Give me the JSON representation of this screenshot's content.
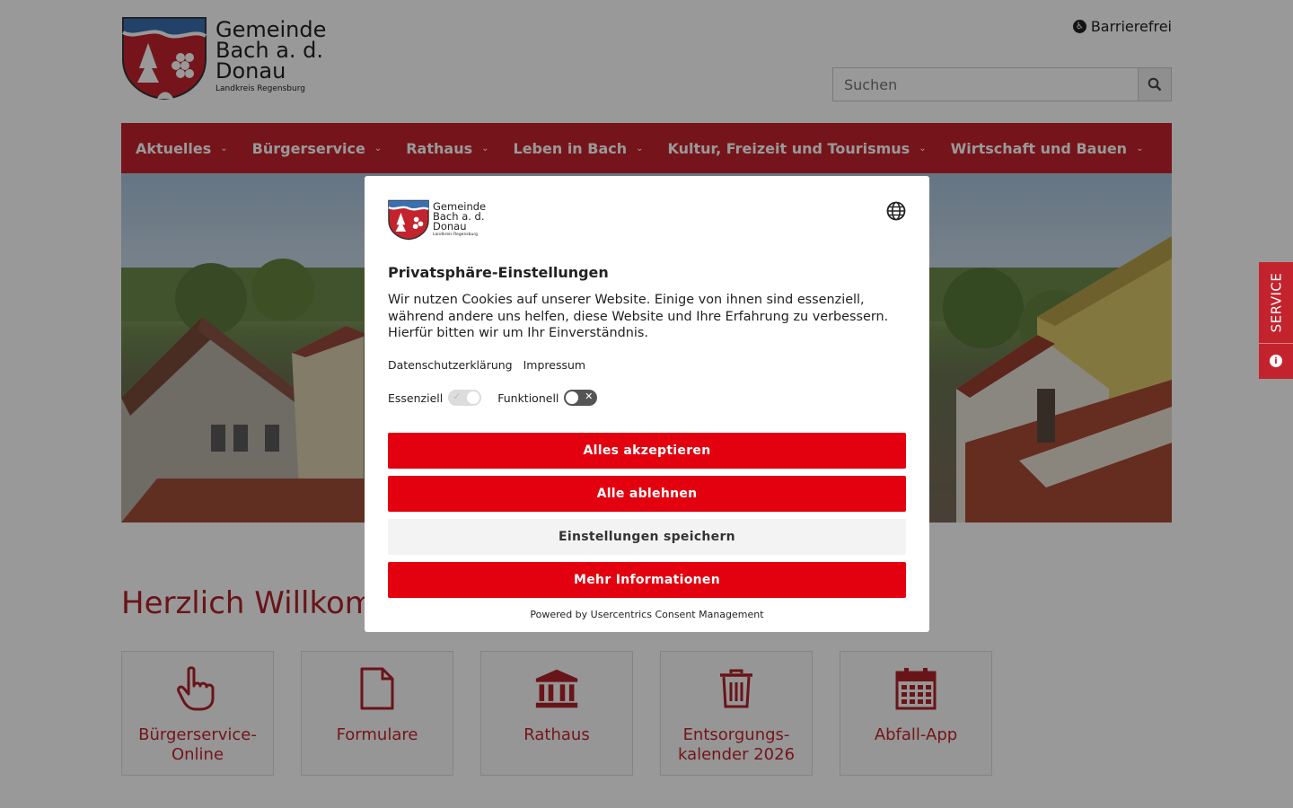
{
  "header": {
    "logo": {
      "line1": "Gemeinde",
      "line2": "Bach a. d.",
      "line3": "Donau",
      "subtitle": "Landkreis Regensburg"
    },
    "accessibility_label": "Barrierefrei",
    "search": {
      "placeholder": "Suchen",
      "icon": "search-icon"
    }
  },
  "nav": {
    "items": [
      {
        "label": "Aktuelles"
      },
      {
        "label": "Bürgerservice"
      },
      {
        "label": "Rathaus"
      },
      {
        "label": "Leben in Bach"
      },
      {
        "label": "Kultur, Freizeit und Tourismus"
      },
      {
        "label": "Wirtschaft und Bauen"
      }
    ]
  },
  "main": {
    "welcome": "Herzlich Willkommen",
    "tiles": [
      {
        "label": "Bürgerservice-Online",
        "icon": "pointing-hand-icon"
      },
      {
        "label": "Formulare",
        "icon": "document-icon"
      },
      {
        "label": "Rathaus",
        "icon": "town-hall-icon"
      },
      {
        "label": "Entsorgungs-kalender 2026",
        "icon": "trash-icon"
      },
      {
        "label": "Abfall-App",
        "icon": "calendar-icon"
      }
    ]
  },
  "service_tab": {
    "label": "SERVICE",
    "icon": "info-icon"
  },
  "consent": {
    "logo": {
      "line1": "Gemeinde",
      "line2": "Bach a. d.",
      "line3": "Donau",
      "subtitle": "Landkreis Regensburg"
    },
    "language_icon": "globe-icon",
    "title": "Privatsphäre-Einstellungen",
    "description": "Wir nutzen Cookies auf unserer Website. Einige von ihnen sind essenziell, während andere uns helfen, diese Website und Ihre Erfahrung zu verbessern. Hierfür bitten wir um Ihr Einverständnis.",
    "links": {
      "privacy": "Datenschutzerklärung",
      "imprint": "Impressum"
    },
    "toggles": [
      {
        "label": "Essenziell",
        "state": "on-disabled"
      },
      {
        "label": "Funktionell",
        "state": "off"
      }
    ],
    "buttons": {
      "accept_all": "Alles akzeptieren",
      "deny_all": "Alle ablehnen",
      "save": "Einstellungen speichern",
      "more_info": "Mehr Informationen"
    },
    "powered_by": "Powered by Usercentrics Consent Management"
  },
  "colors": {
    "brand_red": "#c3232d",
    "consent_red": "#e3000f"
  }
}
